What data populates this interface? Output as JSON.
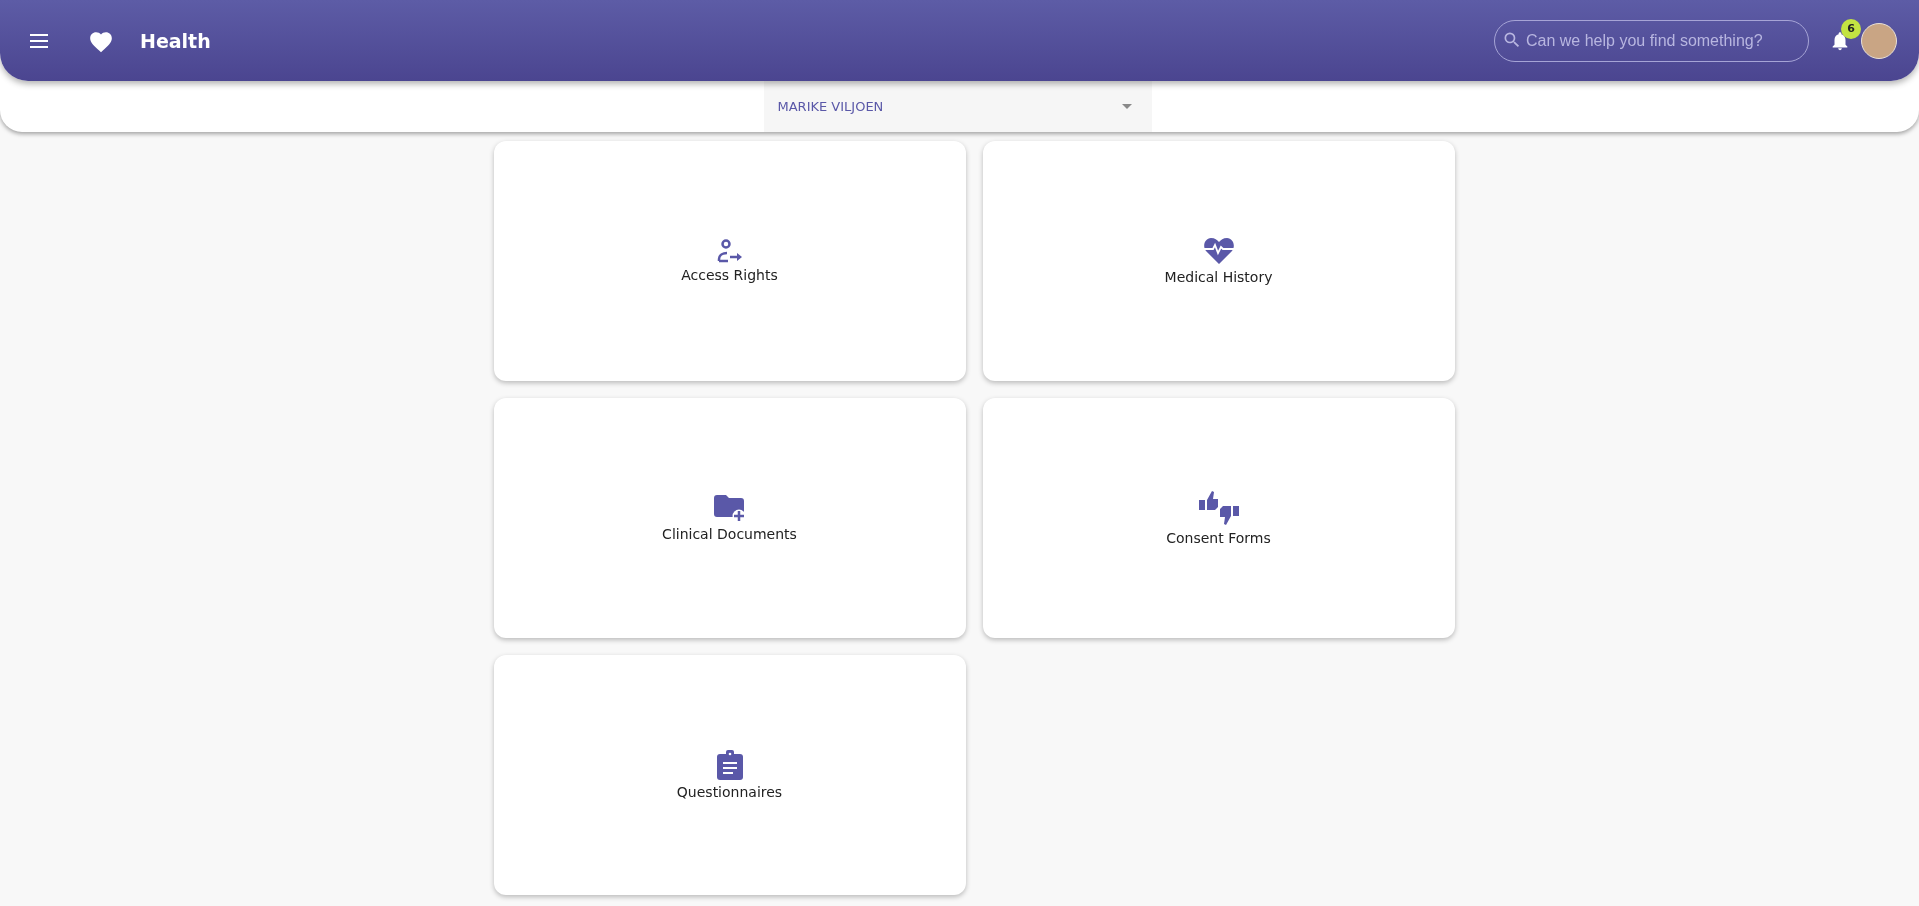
{
  "header": {
    "title": "Health",
    "search": {
      "placeholder": "Can we help you find something?"
    },
    "notifications": {
      "count": "6"
    }
  },
  "patient_selector": {
    "value": "MARIKE VILJOEN"
  },
  "cards": [
    {
      "kind": "access",
      "label": "Access Rights"
    },
    {
      "kind": "history",
      "label": "Medical History"
    },
    {
      "kind": "documents",
      "label": "Clinical Documents"
    },
    {
      "kind": "consent",
      "label": "Consent Forms"
    },
    {
      "kind": "questionnaire",
      "label": "Questionnaires"
    }
  ]
}
